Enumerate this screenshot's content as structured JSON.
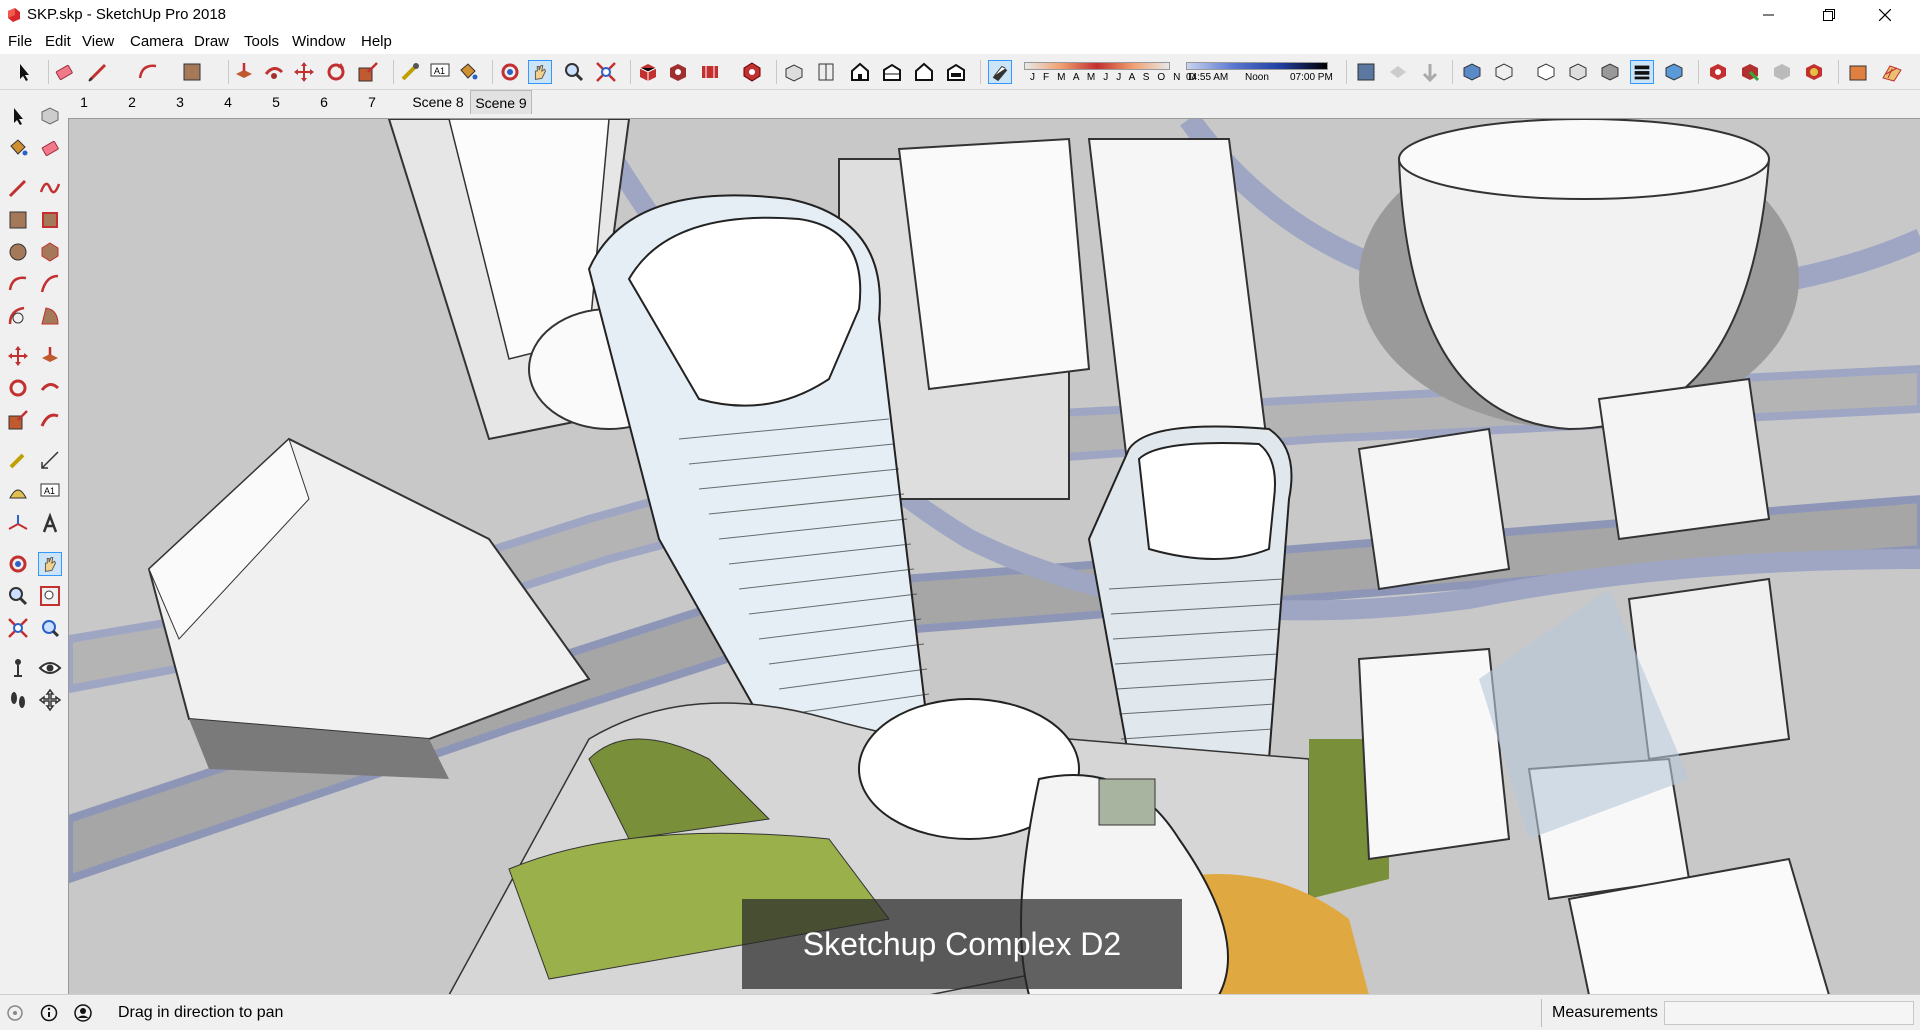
{
  "window": {
    "title": "SKP.skp - SketchUp Pro 2018",
    "minimize_icon": "minimize-icon",
    "maximize_icon": "restore-icon",
    "close_icon": "close-icon"
  },
  "menu": {
    "items": [
      "File",
      "Edit",
      "View",
      "Camera",
      "Draw",
      "Tools",
      "Window",
      "Help"
    ]
  },
  "shadow_settings": {
    "months": "J F M A M J J A S O N D",
    "time_start": "04:55 AM",
    "time_mid": "Noon",
    "time_end": "07:00 PM"
  },
  "scenes": {
    "tabs": [
      "1",
      "2",
      "3",
      "4",
      "5",
      "6",
      "7",
      "Scene 8",
      "Scene 9"
    ],
    "active": "Scene 9"
  },
  "viewport": {
    "caption": "Sketchup Complex D2"
  },
  "status": {
    "text": "Drag in direction to pan",
    "measurements_label": "Measurements",
    "measurements_value": ""
  },
  "colors": {
    "accent": "#3399ff",
    "road_blue": "#9ea6c4",
    "grass": "#7a8f3a",
    "ground": "#c4c4c4"
  }
}
